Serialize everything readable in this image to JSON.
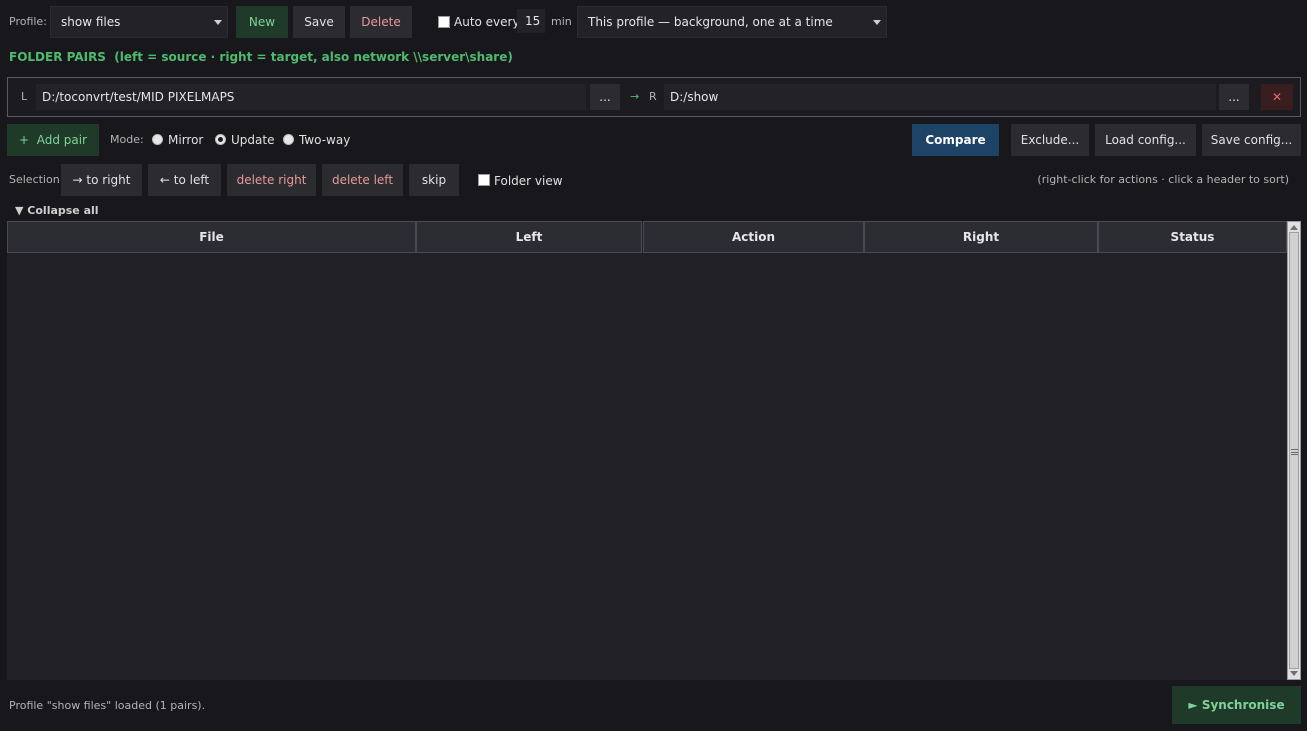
{
  "toolbar": {
    "profile_label": "Profile:",
    "profile_value": "show files",
    "new_label": "New",
    "save_label": "Save",
    "delete_label": "Delete",
    "auto_every_label": "Auto every",
    "auto_every_value": "15",
    "min_label": "min",
    "schedule_value": "This profile — background, one at a time"
  },
  "folder_pairs": {
    "heading": "FOLDER PAIRS  (left = source · right = target, also network \\\\server\\share)",
    "pair": {
      "left_tag": "L",
      "left_path": "D:/toconvrt/test/MID PIXELMAPS",
      "browse_left": "...",
      "arrow": "→",
      "right_tag": "R",
      "right_path": "D:/show",
      "browse_right": "...",
      "remove": "✕"
    }
  },
  "actions": {
    "add_pair_label": "+  Add pair",
    "mode_label": "Mode:",
    "modes": [
      "Mirror",
      "Update",
      "Two-way"
    ],
    "selected_mode": "Update",
    "compare_label": "Compare",
    "exclude_label": "Exclude...",
    "load_config_label": "Load config...",
    "save_config_label": "Save config..."
  },
  "selection": {
    "label": "Selection:",
    "to_right": "→ to right",
    "to_left": "← to left",
    "delete_right": "delete right",
    "delete_left": "delete left",
    "skip": "skip",
    "folder_view_label": "Folder view",
    "hint": "(right-click for actions · click a header to sort)"
  },
  "tree": {
    "collapse_all": "▼ Collapse all",
    "columns": [
      "File",
      "Left",
      "Action",
      "Right",
      "Status"
    ],
    "rows": []
  },
  "status_bar": {
    "message": "Profile \"show files\" loaded (1 pairs).",
    "synchronise_label": "► Synchronise"
  },
  "colors": {
    "background": "#18181c",
    "accent_green": "#4dbb6e",
    "compare_blue": "#1d4466",
    "danger_red": "#e79a9a"
  }
}
